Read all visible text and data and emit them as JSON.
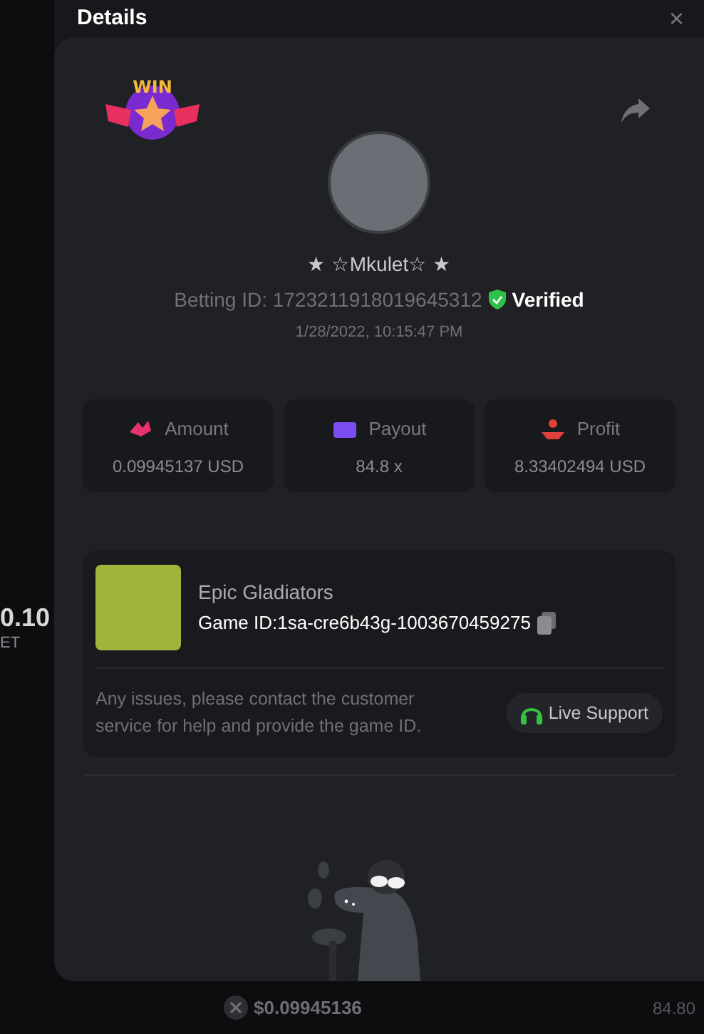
{
  "background": {
    "value_fragment": "0.10",
    "label_fragment": "ET"
  },
  "dialog": {
    "title": "Details",
    "close": "×"
  },
  "badge": {
    "label": "WIN"
  },
  "player": {
    "name": "★ ☆Mkulet☆ ★",
    "betting_id": "Betting ID: 1723211918019645312",
    "verified": "Verified",
    "time": "1/28/2022, 10:15:47 PM"
  },
  "stats": [
    {
      "label": "Amount",
      "value": "0.09945137 USD",
      "color": "#e5336d"
    },
    {
      "label": "Payout",
      "value": "84.8 x",
      "color": "#7b4cf0"
    },
    {
      "label": "Profit",
      "value": "8.33402494 USD",
      "color": "#e0403a"
    }
  ],
  "game": {
    "name": "Epic Gladiators",
    "game_id": "Game ID:1sa-cre6b43g-1003670459275",
    "help": "Any issues, please contact the customer service for help and provide the game ID.",
    "support": "Live Support"
  },
  "bottom_bar": {
    "amount": "$0.09945136",
    "payout": "84.80"
  }
}
